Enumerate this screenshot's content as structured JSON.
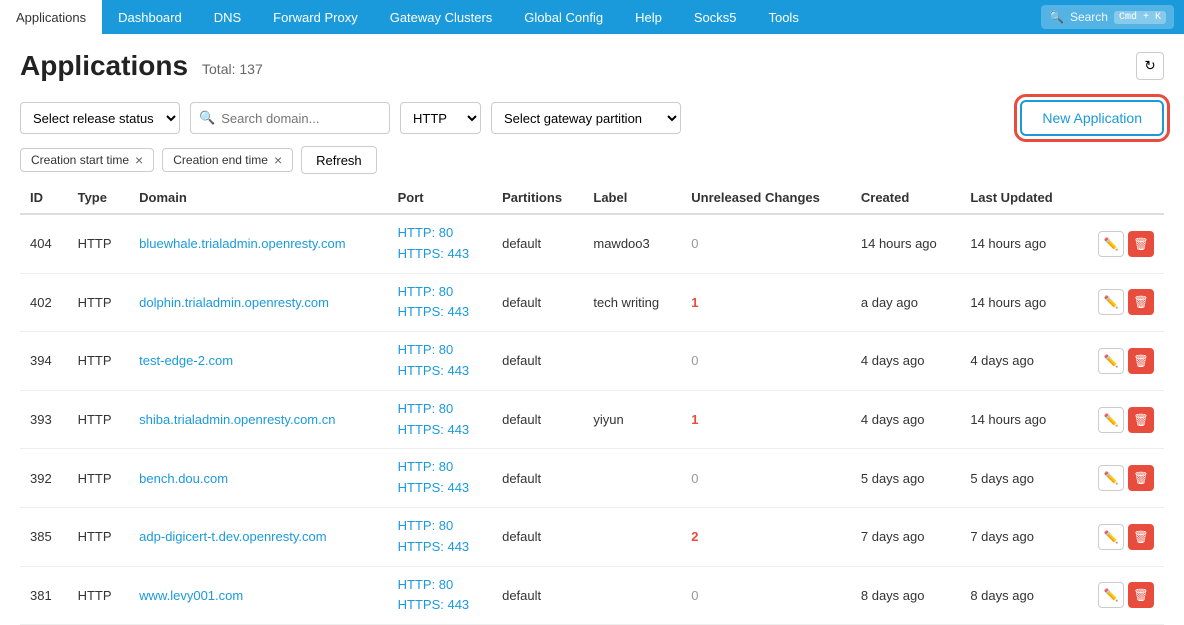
{
  "nav": {
    "items": [
      {
        "label": "Applications",
        "active": true
      },
      {
        "label": "Dashboard",
        "active": false
      },
      {
        "label": "DNS",
        "active": false
      },
      {
        "label": "Forward Proxy",
        "active": false
      },
      {
        "label": "Gateway Clusters",
        "active": false
      },
      {
        "label": "Global Config",
        "active": false
      },
      {
        "label": "Help",
        "active": false
      },
      {
        "label": "Socks5",
        "active": false
      },
      {
        "label": "Tools",
        "active": false
      }
    ],
    "search_placeholder": "Search",
    "search_shortcut": "Cmd + K"
  },
  "header": {
    "title": "Applications",
    "total_label": "Total: 137"
  },
  "filters": {
    "release_status_placeholder": "Select release status",
    "search_placeholder": "Search domain...",
    "protocol_value": "HTTP",
    "gateway_partition_placeholder": "Select gateway partition",
    "new_app_label": "New Application"
  },
  "filter_tags": [
    {
      "label": "Creation start time"
    },
    {
      "label": "Creation end time"
    }
  ],
  "refresh_label": "Refresh",
  "table": {
    "columns": [
      "ID",
      "Type",
      "Domain",
      "Port",
      "Partitions",
      "Label",
      "Unreleased Changes",
      "Created",
      "Last Updated",
      ""
    ],
    "rows": [
      {
        "id": "404",
        "type": "HTTP",
        "domain": "bluewhale.trialadmin.openresty.com",
        "port_http": "HTTP:  80",
        "port_https": "HTTPS:  443",
        "partitions": "default",
        "label": "mawdoo3",
        "unreleased": "0",
        "unreleased_highlight": false,
        "created": "14 hours ago",
        "last_updated": "14 hours ago"
      },
      {
        "id": "402",
        "type": "HTTP",
        "domain": "dolphin.trialadmin.openresty.com",
        "port_http": "HTTP:  80",
        "port_https": "HTTPS:  443",
        "partitions": "default",
        "label": "tech writing",
        "unreleased": "1",
        "unreleased_highlight": true,
        "created": "a day ago",
        "last_updated": "14 hours ago"
      },
      {
        "id": "394",
        "type": "HTTP",
        "domain": "test-edge-2.com",
        "port_http": "HTTP:  80",
        "port_https": "HTTPS:  443",
        "partitions": "default",
        "label": "",
        "unreleased": "0",
        "unreleased_highlight": false,
        "created": "4 days ago",
        "last_updated": "4 days ago"
      },
      {
        "id": "393",
        "type": "HTTP",
        "domain": "shiba.trialadmin.openresty.com.cn",
        "port_http": "HTTP:  80",
        "port_https": "HTTPS:  443",
        "partitions": "default",
        "label": "yiyun",
        "unreleased": "1",
        "unreleased_highlight": true,
        "created": "4 days ago",
        "last_updated": "14 hours ago"
      },
      {
        "id": "392",
        "type": "HTTP",
        "domain": "bench.dou.com",
        "port_http": "HTTP:  80",
        "port_https": "HTTPS:  443",
        "partitions": "default",
        "label": "",
        "unreleased": "0",
        "unreleased_highlight": false,
        "created": "5 days ago",
        "last_updated": "5 days ago"
      },
      {
        "id": "385",
        "type": "HTTP",
        "domain": "adp-digicert-t.dev.openresty.com",
        "port_http": "HTTP:  80",
        "port_https": "HTTPS:  443",
        "partitions": "default",
        "label": "",
        "unreleased": "2",
        "unreleased_highlight": true,
        "created": "7 days ago",
        "last_updated": "7 days ago"
      },
      {
        "id": "381",
        "type": "HTTP",
        "domain": "www.levy001.com",
        "port_http": "HTTP:  80",
        "port_https": "HTTPS:  443",
        "partitions": "default",
        "label": "",
        "unreleased": "0",
        "unreleased_highlight": false,
        "created": "8 days ago",
        "last_updated": "8 days ago"
      }
    ]
  }
}
